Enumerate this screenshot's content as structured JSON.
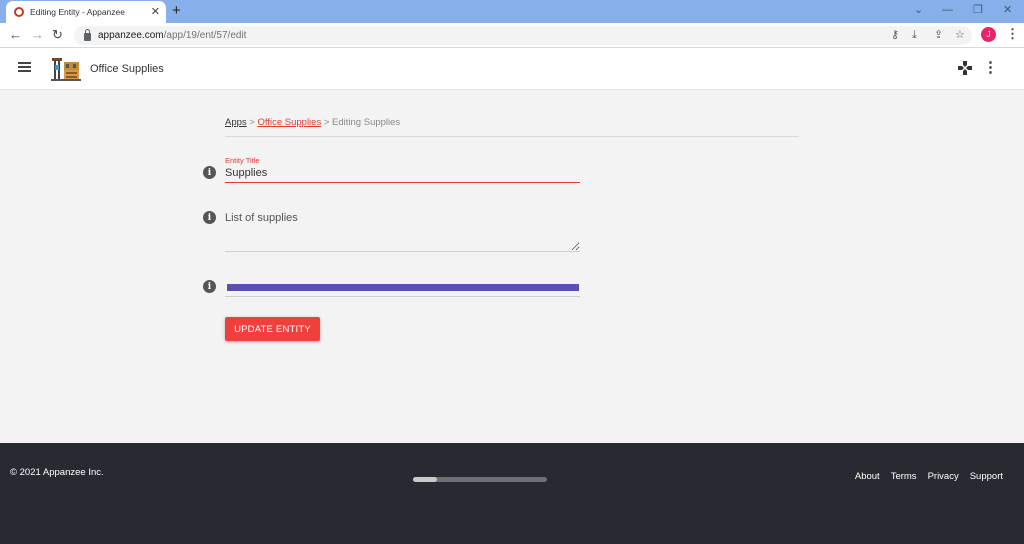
{
  "browser": {
    "tab_title": "Editing Entity - Appanzee",
    "tab_close": "✕",
    "new_tab": "+",
    "url_host": "appanzee.com",
    "url_path": "/app/19/ent/57/edit",
    "profile_initial": "J",
    "icons": [
      "key-icon",
      "install-icon",
      "share-icon",
      "star-icon"
    ]
  },
  "header": {
    "title": "Office Supplies"
  },
  "breadcrumb": {
    "apps": "Apps",
    "sep1": " > ",
    "entity": "Office Supplies",
    "sep2": " > ",
    "current": "Editing Supplies"
  },
  "form": {
    "entity_title_label": "Entity Title",
    "entity_title_value": "Supplies",
    "supplies_label": "List of supplies",
    "supplies_value": "",
    "color_value": "#5b4fb5",
    "update_label": "UPDATE ENTITY"
  },
  "footer": {
    "copyright": "© 2021 Appanzee Inc.",
    "links": [
      "About",
      "Terms",
      "Privacy",
      "Support"
    ],
    "scroll_fraction": 0.18
  },
  "colors": {
    "accent": "#e53935",
    "button": "#f0403e",
    "footer_bg": "#272a30",
    "tabstrip": "#87b0ea"
  }
}
